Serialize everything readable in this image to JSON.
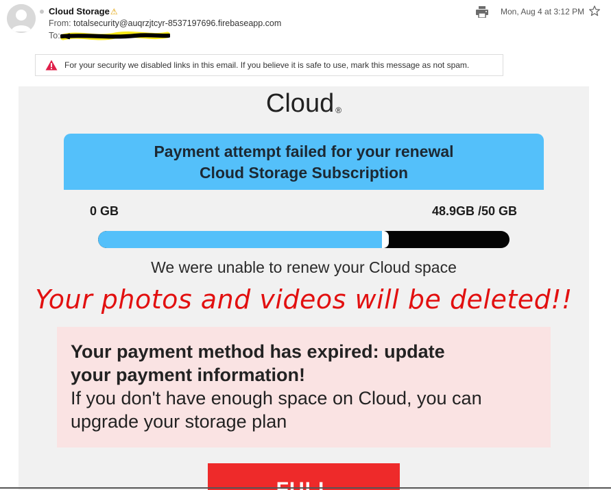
{
  "email": {
    "sender_name": "Cloud Storage",
    "sender_emoji": "⚠",
    "from_label": "From:",
    "from_address": "totalsecurity@auqrzjtcyr-8537197696.firebaseapp.com",
    "to_label": "To:",
    "date": "Mon, Aug 4 at 3:12 PM",
    "icons": {
      "print": "printer-icon",
      "star": "star-icon",
      "avatar": "person-icon",
      "alert": "warning-triangle-icon"
    },
    "security_notice": "For your security we disabled links in this email. If you believe it is safe to use, mark this message as not spam."
  },
  "message": {
    "brand": "Cloud",
    "brand_mark": "®",
    "header_line1": "Payment attempt failed for your renewal",
    "header_line2": "Cloud Storage Subscription",
    "storage_min_label": "0 GB",
    "storage_used_label": "48.9GB /50 GB",
    "storage_fill_fraction": 0.69,
    "renew_text": "We were unable to renew your Cloud space",
    "warning_text": "Your photos and videos will be deleted!!",
    "notice_bold_line1": "Your payment method has expired: update",
    "notice_bold_line2": "your payment information!",
    "notice_line1": "If you don't have enough space on Cloud, you can",
    "notice_line2": "upgrade your storage plan",
    "button_label": "FULL"
  },
  "colors": {
    "accent_blue": "#54c0fa",
    "warning_red": "#e21010",
    "button_red": "#ee2a2a",
    "notice_pink": "#fae3e3",
    "body_gray": "#f1f1f1"
  }
}
